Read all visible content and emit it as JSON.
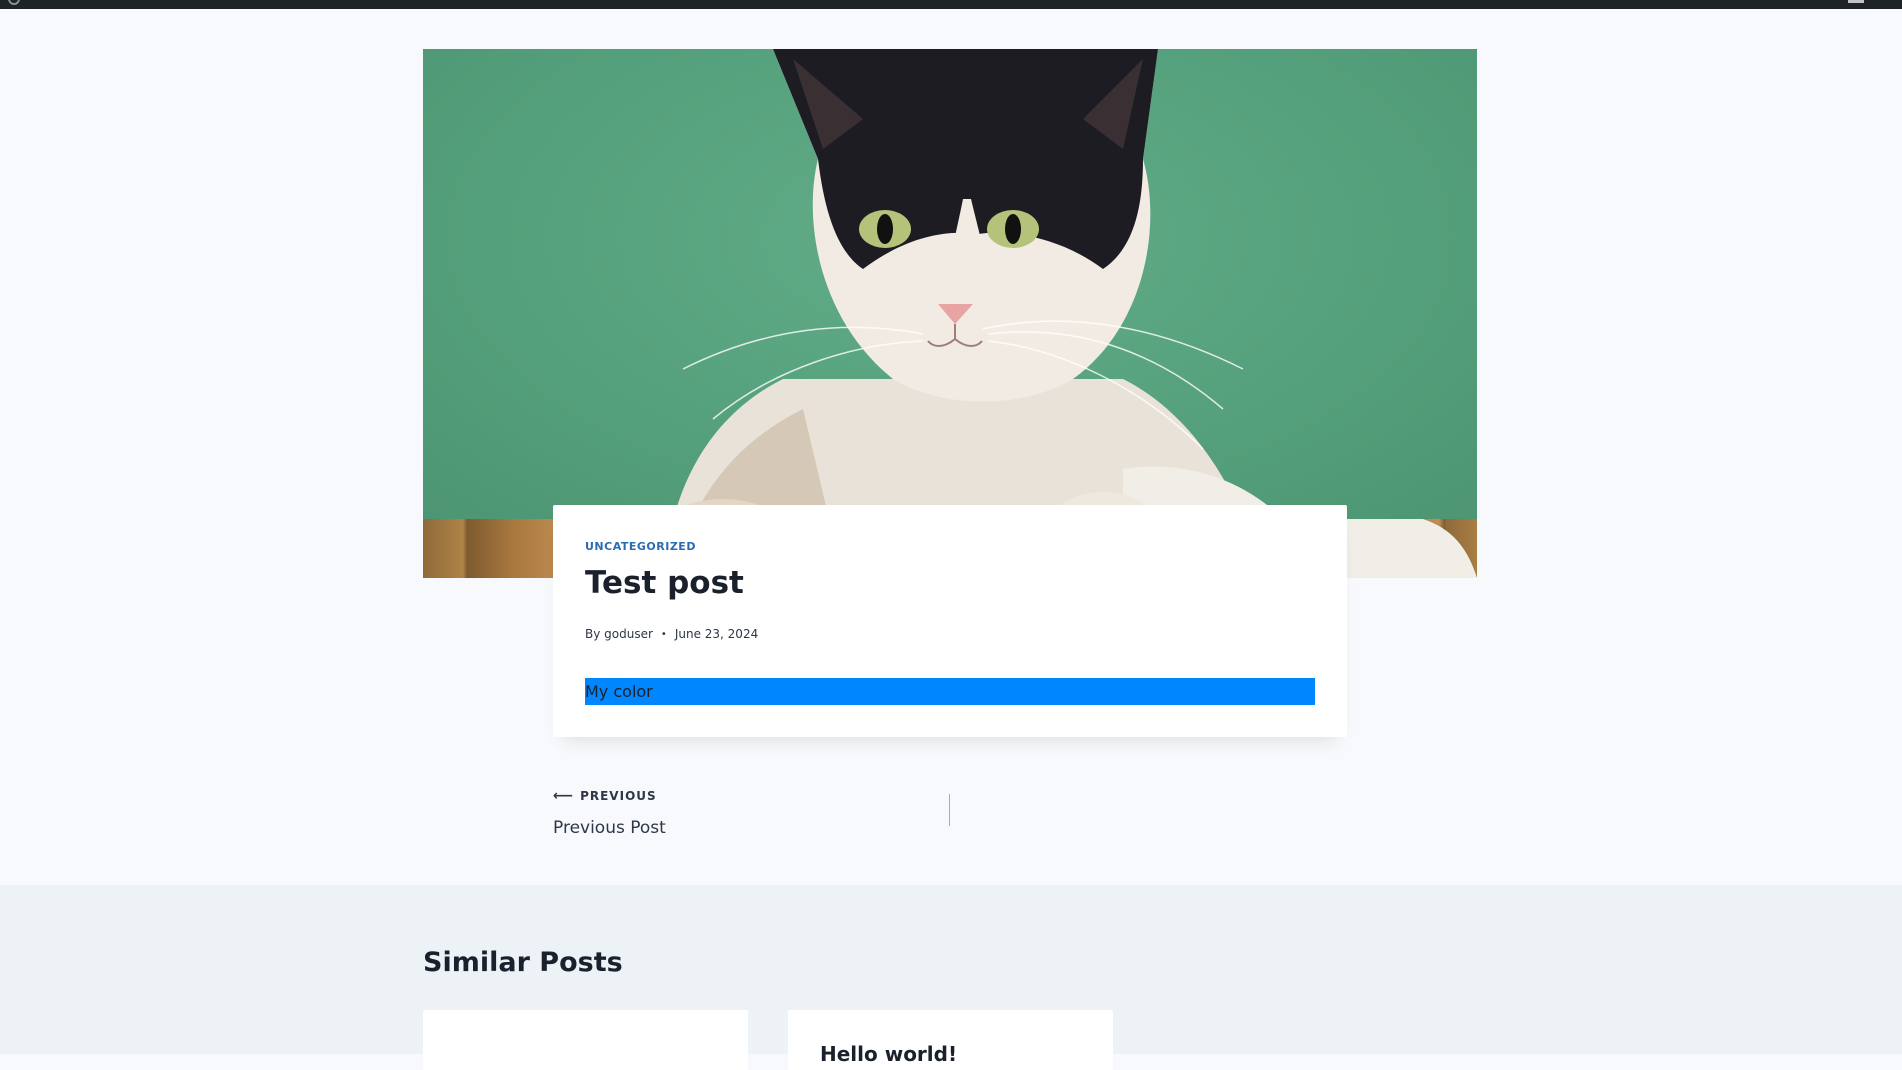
{
  "post": {
    "category": "UNCATEGORIZED",
    "title": "Test post",
    "by_prefix": "By",
    "author": "goduser",
    "separator": "•",
    "date": "June 23, 2024",
    "color_block_text": "My color",
    "color_block_bg": "#0087ff"
  },
  "post_nav": {
    "arrow": "⟵",
    "previous_label": "PREVIOUS",
    "previous_title": "Previous Post"
  },
  "similar": {
    "heading": "Similar Posts",
    "cards": [
      {
        "title": ""
      },
      {
        "title": "Hello world!"
      }
    ]
  },
  "colors": {
    "accent": "#2b6cb0",
    "page_bg": "#f7f9fc",
    "section_bg": "#edf2f7",
    "admin_bar": "#1d2327"
  }
}
